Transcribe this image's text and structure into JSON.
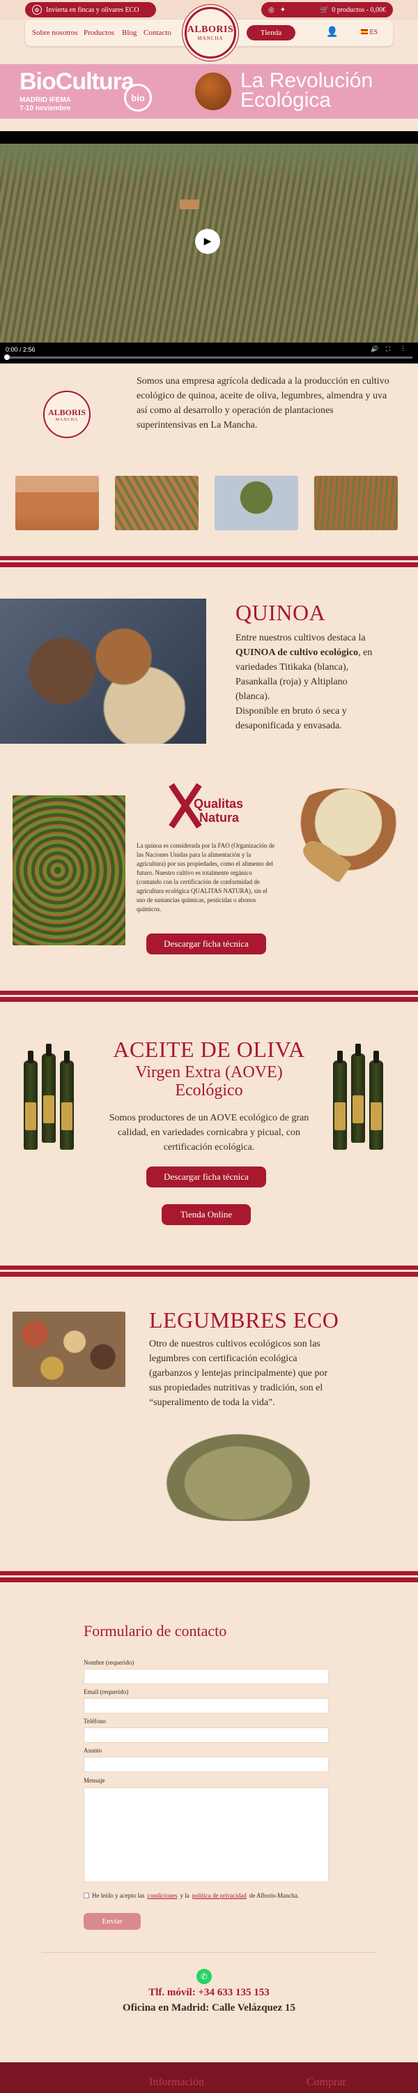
{
  "topbar": {
    "invest_label": "Invierta en fincas y olivares ECO",
    "cart_label": "0 productos - 0,00€",
    "social_icons": [
      "instagram-icon",
      "twitter-icon"
    ]
  },
  "nav": {
    "items": [
      {
        "label": "Sobre nosotros"
      },
      {
        "label": "Productos"
      },
      {
        "label": "Blog"
      },
      {
        "label": "Contacto"
      }
    ],
    "logo_main": "ALBORIS",
    "logo_sub": "MANCHA",
    "shop_button": "Tienda",
    "lang": "ES"
  },
  "banner": {
    "title": "BioCultura",
    "badge": "bio",
    "sub1": "MADRID IFEMA",
    "sub2": "7-10 noviembre",
    "right_line1": "La Revolución",
    "right_line2": "Ecológica"
  },
  "video": {
    "time": "0:00 / 2:56",
    "progress": 0.0
  },
  "intro": {
    "text": "Somos una empresa agrícola dedicada a la producción en cultivo ecológico de quinoa, aceite de oliva, legumbres, almendra y uva así como al desarrollo y operación de plantaciones superintensivas en La Mancha.",
    "logo_main": "ALBORIS",
    "logo_sub": "MANCHA"
  },
  "quinoa": {
    "title": "QUINOA",
    "p1": "Entre nuestros cultivos destaca la",
    "p1_bold": "QUINOA de cultivo ecológico",
    "p2": ", en variedades Titikaka (blanca), Pasankalla (roja) y Altiplano (blanca).",
    "p3": "Disponible en bruto ó seca y desaponificada y envasada.",
    "qn_logo_line1": "Qualitas",
    "qn_logo_line2": "Natura",
    "detail": "La quinoa es considerada por la FAO (Organización de las Naciones Unidas para la alimentación y la agricultura) por sus propiedades, como el alimento del futuro. Nuestro cultivo es totalmente orgánico (contando con la certificación de conformidad de agricultura ecológica QUALITAS NATURA), sin el uso de sustancias químicas, pesticidas o abonos químicos.",
    "download": "Descargar ficha técnica"
  },
  "olive": {
    "title": "ACEITE DE OLIVA",
    "subtitle1": "Virgen Extra (AOVE)",
    "subtitle2": "Ecológico",
    "text": "Somos productores de un AOVE ecológico de gran calidad, en variedades cornicabra y picual, con certificación ecológica.",
    "download": "Descargar ficha técnica",
    "shop": "Tienda Online"
  },
  "legumes": {
    "title": "LEGUMBRES ECO",
    "text": "Otro de nuestros cultivos ecológicos son las legumbres con certificación ecológica (garbanzos y lentejas principalmente) que por sus propiedades nutritivas y tradición, son el “superalimento de toda la vida”."
  },
  "form": {
    "title": "Formulario de contacto",
    "name_label": "Nombre (requerido)",
    "email_label": "Email (requerido)",
    "phone_label": "Teléfono",
    "subject_label": "Asunto",
    "message_label": "Mensaje",
    "consent_pre": "He leído y acepto las ",
    "consent_link1": "condiciones",
    "consent_mid": " y la ",
    "consent_link2": "política de privacidad",
    "consent_post": " de Alboris-Mancha.",
    "submit": "Enviar"
  },
  "contact": {
    "phone": "Tlf. móvil: +34 633 135 153",
    "office": "Oficina en Madrid: Calle Velázquez 15"
  },
  "footer": {
    "col1": "Información",
    "col2": "Comprar"
  },
  "colors": {
    "brand": "#a8192e",
    "background": "#f6e4d4"
  }
}
